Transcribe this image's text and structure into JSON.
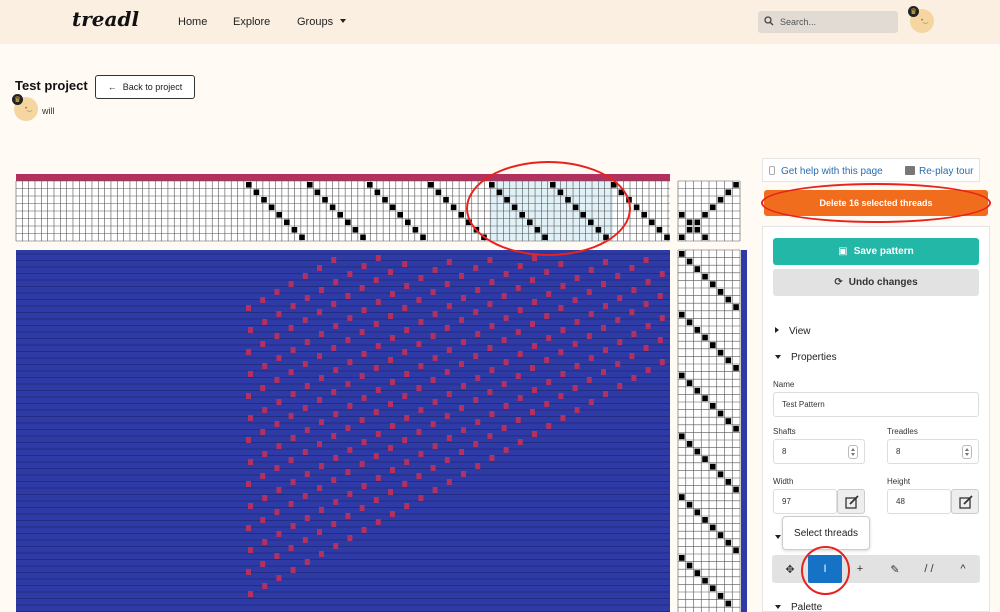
{
  "nav": {
    "logo": "treadl",
    "links": [
      {
        "label": "Home"
      },
      {
        "label": "Explore"
      },
      {
        "label": "Groups"
      }
    ],
    "search_placeholder": "Search..."
  },
  "project": {
    "title": "Test project",
    "back_label": "Back to project",
    "owner": "will"
  },
  "help": {
    "help_label": "Get help with this page",
    "tour_label": "Re-play tour"
  },
  "actions": {
    "delete_label": "Delete 16 selected threads",
    "save_label": "Save pattern",
    "undo_label": "Undo changes"
  },
  "sections": {
    "view": "View",
    "properties": "Properties",
    "palette": "Palette"
  },
  "properties": {
    "name_label": "Name",
    "name_value": "Test Pattern",
    "shafts_label": "Shafts",
    "shafts_value": "8",
    "treadles_label": "Treadles",
    "treadles_value": "8",
    "width_label": "Width",
    "width_value": "97",
    "height_label": "Height",
    "height_value": "48"
  },
  "tooltip": "Select threads",
  "tools": [
    {
      "icon": "move-icon",
      "glyph": "✥",
      "active": false
    },
    {
      "icon": "cursor-text-icon",
      "glyph": "I",
      "active": true
    },
    {
      "icon": "plus-icon",
      "glyph": "+",
      "active": false
    },
    {
      "icon": "brush-icon",
      "glyph": "✎",
      "active": false
    },
    {
      "icon": "diagonal-lines-icon",
      "glyph": "/ /",
      "active": false
    },
    {
      "icon": "chevron-up-icon",
      "glyph": "^",
      "active": false
    }
  ],
  "colors": {
    "warp": "#b2315f",
    "weft": "#2e3aa5",
    "selection": "#e1f1f8",
    "accent_orange": "#f16d1e",
    "accent_teal": "#23b7a8",
    "callout": "#e8221c"
  }
}
